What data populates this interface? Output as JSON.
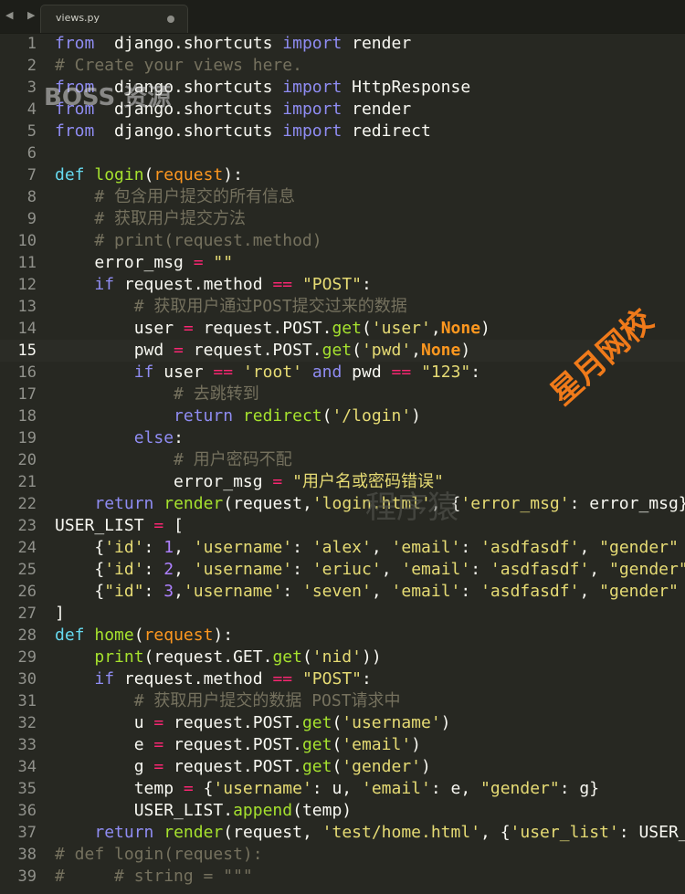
{
  "tabbar": {
    "file_name": "views.py"
  },
  "watermarks": {
    "boss": "BOSS 资源",
    "xingyue": "星月网校",
    "cxy": "程序猿"
  },
  "lines": [
    {
      "n": "1",
      "t": [
        [
          "kw",
          "from"
        ],
        [
          "",
          "  django.shortcuts "
        ],
        [
          "kw",
          "import"
        ],
        [
          "",
          " render"
        ]
      ]
    },
    {
      "n": "2",
      "t": [
        [
          "cmt",
          "# Create your views here."
        ]
      ]
    },
    {
      "n": "3",
      "t": [
        [
          "kw",
          "from"
        ],
        [
          "",
          "  django.shortcuts "
        ],
        [
          "kw",
          "import"
        ],
        [
          "",
          " HttpResponse"
        ]
      ]
    },
    {
      "n": "4",
      "t": [
        [
          "kw",
          "from"
        ],
        [
          "",
          "  django.shortcuts "
        ],
        [
          "kw",
          "import"
        ],
        [
          "",
          " render"
        ]
      ]
    },
    {
      "n": "5",
      "t": [
        [
          "kw",
          "from"
        ],
        [
          "",
          "  django.shortcuts "
        ],
        [
          "kw",
          "import"
        ],
        [
          "",
          " redirect"
        ]
      ]
    },
    {
      "n": "6",
      "t": []
    },
    {
      "n": "7",
      "t": [
        [
          "dkw",
          "def"
        ],
        [
          "",
          " "
        ],
        [
          "fn",
          "login"
        ],
        [
          "",
          "("
        ],
        [
          "param",
          "request"
        ],
        [
          "",
          "):"
        ]
      ]
    },
    {
      "n": "8",
      "t": [
        [
          "",
          "    "
        ],
        [
          "cmt",
          "# 包含用户提交的所有信息"
        ]
      ]
    },
    {
      "n": "9",
      "t": [
        [
          "",
          "    "
        ],
        [
          "cmt",
          "# 获取用户提交方法"
        ]
      ]
    },
    {
      "n": "10",
      "t": [
        [
          "",
          "    "
        ],
        [
          "cmt",
          "# print(request.method)"
        ]
      ]
    },
    {
      "n": "11",
      "t": [
        [
          "",
          "    error_msg "
        ],
        [
          "op",
          "="
        ],
        [
          "",
          " "
        ],
        [
          "str",
          "\"\""
        ]
      ]
    },
    {
      "n": "12",
      "t": [
        [
          "",
          "    "
        ],
        [
          "kw",
          "if"
        ],
        [
          "",
          " request.method "
        ],
        [
          "op",
          "=="
        ],
        [
          "",
          " "
        ],
        [
          "str",
          "\"POST\""
        ],
        [
          "",
          ":"
        ]
      ]
    },
    {
      "n": "13",
      "t": [
        [
          "",
          "        "
        ],
        [
          "cmt",
          "# 获取用户通过POST提交过来的数据"
        ]
      ]
    },
    {
      "n": "14",
      "t": [
        [
          "",
          "        user "
        ],
        [
          "op",
          "="
        ],
        [
          "",
          " request.POST."
        ],
        [
          "fn",
          "get"
        ],
        [
          "",
          "("
        ],
        [
          "str",
          "'user'"
        ],
        [
          "",
          ","
        ],
        [
          "const",
          "None"
        ],
        [
          "",
          ")"
        ]
      ]
    },
    {
      "n": "15",
      "t": [
        [
          "",
          "        pwd "
        ],
        [
          "op",
          "="
        ],
        [
          "",
          " request.POST."
        ],
        [
          "fn",
          "get"
        ],
        [
          "",
          "("
        ],
        [
          "str",
          "'pwd'"
        ],
        [
          "",
          ","
        ],
        [
          "const",
          "None"
        ],
        [
          "",
          ")"
        ]
      ]
    },
    {
      "n": "16",
      "t": [
        [
          "",
          "        "
        ],
        [
          "kw",
          "if"
        ],
        [
          "",
          " user "
        ],
        [
          "op",
          "=="
        ],
        [
          "",
          " "
        ],
        [
          "str",
          "'root'"
        ],
        [
          "",
          " "
        ],
        [
          "kw",
          "and"
        ],
        [
          "",
          " pwd "
        ],
        [
          "op",
          "=="
        ],
        [
          "",
          " "
        ],
        [
          "str",
          "\"123\""
        ],
        [
          "",
          ":"
        ]
      ]
    },
    {
      "n": "17",
      "t": [
        [
          "",
          "            "
        ],
        [
          "cmt",
          "# 去跳转到"
        ]
      ]
    },
    {
      "n": "18",
      "t": [
        [
          "",
          "            "
        ],
        [
          "kw",
          "return"
        ],
        [
          "",
          " "
        ],
        [
          "fn",
          "redirect"
        ],
        [
          "",
          "("
        ],
        [
          "str",
          "'/login'"
        ],
        [
          "",
          ")"
        ]
      ]
    },
    {
      "n": "19",
      "t": [
        [
          "",
          "        "
        ],
        [
          "kw",
          "else"
        ],
        [
          "",
          ":"
        ]
      ]
    },
    {
      "n": "20",
      "t": [
        [
          "",
          "            "
        ],
        [
          "cmt",
          "# 用户密码不配"
        ]
      ]
    },
    {
      "n": "21",
      "t": [
        [
          "",
          "            error_msg "
        ],
        [
          "op",
          "="
        ],
        [
          "",
          " "
        ],
        [
          "str",
          "\"用户名或密码错误\""
        ]
      ]
    },
    {
      "n": "22",
      "t": [
        [
          "",
          "    "
        ],
        [
          "kw",
          "return"
        ],
        [
          "",
          " "
        ],
        [
          "fn",
          "render"
        ],
        [
          "",
          "(request,"
        ],
        [
          "str",
          "'login.html'"
        ],
        [
          "",
          ", {"
        ],
        [
          "str",
          "'error_msg'"
        ],
        [
          "",
          ": error_msg})"
        ]
      ]
    },
    {
      "n": "23",
      "t": [
        [
          "",
          "USER_LIST "
        ],
        [
          "op",
          "="
        ],
        [
          "",
          " ["
        ]
      ]
    },
    {
      "n": "24",
      "t": [
        [
          "",
          "    {"
        ],
        [
          "str",
          "'id'"
        ],
        [
          "",
          ": "
        ],
        [
          "num",
          "1"
        ],
        [
          "",
          ", "
        ],
        [
          "str",
          "'username'"
        ],
        [
          "",
          ": "
        ],
        [
          "str",
          "'alex'"
        ],
        [
          "",
          ", "
        ],
        [
          "str",
          "'email'"
        ],
        [
          "",
          ": "
        ],
        [
          "str",
          "'asdfasdf'"
        ],
        [
          "",
          ", "
        ],
        [
          "str",
          "\"gender\""
        ]
      ]
    },
    {
      "n": "25",
      "t": [
        [
          "",
          "    {"
        ],
        [
          "str",
          "'id'"
        ],
        [
          "",
          ": "
        ],
        [
          "num",
          "2"
        ],
        [
          "",
          ", "
        ],
        [
          "str",
          "'username'"
        ],
        [
          "",
          ": "
        ],
        [
          "str",
          "'eriuc'"
        ],
        [
          "",
          ", "
        ],
        [
          "str",
          "'email'"
        ],
        [
          "",
          ": "
        ],
        [
          "str",
          "'asdfasdf'"
        ],
        [
          "",
          ", "
        ],
        [
          "str",
          "\"gender\""
        ]
      ]
    },
    {
      "n": "26",
      "t": [
        [
          "",
          "    {"
        ],
        [
          "str",
          "\"id\""
        ],
        [
          "",
          ": "
        ],
        [
          "num",
          "3"
        ],
        [
          "",
          ","
        ],
        [
          "str",
          "'username'"
        ],
        [
          "",
          ": "
        ],
        [
          "str",
          "'seven'"
        ],
        [
          "",
          ", "
        ],
        [
          "str",
          "'email'"
        ],
        [
          "",
          ": "
        ],
        [
          "str",
          "'asdfasdf'"
        ],
        [
          "",
          ", "
        ],
        [
          "str",
          "\"gender\""
        ]
      ]
    },
    {
      "n": "27",
      "t": [
        [
          "",
          "]"
        ]
      ]
    },
    {
      "n": "28",
      "t": [
        [
          "dkw",
          "def"
        ],
        [
          "",
          " "
        ],
        [
          "fn",
          "home"
        ],
        [
          "",
          "("
        ],
        [
          "param",
          "request"
        ],
        [
          "",
          "):"
        ]
      ]
    },
    {
      "n": "29",
      "t": [
        [
          "",
          "    "
        ],
        [
          "fn",
          "print"
        ],
        [
          "",
          "(request.GET."
        ],
        [
          "fn",
          "get"
        ],
        [
          "",
          "("
        ],
        [
          "str",
          "'nid'"
        ],
        [
          "",
          "))"
        ]
      ]
    },
    {
      "n": "30",
      "t": [
        [
          "",
          "    "
        ],
        [
          "kw",
          "if"
        ],
        [
          "",
          " request.method "
        ],
        [
          "op",
          "=="
        ],
        [
          "",
          " "
        ],
        [
          "str",
          "\"POST\""
        ],
        [
          "",
          ":"
        ]
      ]
    },
    {
      "n": "31",
      "t": [
        [
          "",
          "        "
        ],
        [
          "cmt",
          "# 获取用户提交的数据 POST请求中"
        ]
      ]
    },
    {
      "n": "32",
      "t": [
        [
          "",
          "        u "
        ],
        [
          "op",
          "="
        ],
        [
          "",
          " request.POST."
        ],
        [
          "fn",
          "get"
        ],
        [
          "",
          "("
        ],
        [
          "str",
          "'username'"
        ],
        [
          "",
          ")"
        ]
      ]
    },
    {
      "n": "33",
      "t": [
        [
          "",
          "        e "
        ],
        [
          "op",
          "="
        ],
        [
          "",
          " request.POST."
        ],
        [
          "fn",
          "get"
        ],
        [
          "",
          "("
        ],
        [
          "str",
          "'email'"
        ],
        [
          "",
          ")"
        ]
      ]
    },
    {
      "n": "34",
      "t": [
        [
          "",
          "        g "
        ],
        [
          "op",
          "="
        ],
        [
          "",
          " request.POST."
        ],
        [
          "fn",
          "get"
        ],
        [
          "",
          "("
        ],
        [
          "str",
          "'gender'"
        ],
        [
          "",
          ")"
        ]
      ]
    },
    {
      "n": "35",
      "t": [
        [
          "",
          "        temp "
        ],
        [
          "op",
          "="
        ],
        [
          "",
          " {"
        ],
        [
          "str",
          "'username'"
        ],
        [
          "",
          ": u, "
        ],
        [
          "str",
          "'email'"
        ],
        [
          "",
          ": e, "
        ],
        [
          "str",
          "\"gender\""
        ],
        [
          "",
          ": g}"
        ]
      ]
    },
    {
      "n": "36",
      "t": [
        [
          "",
          "        USER_LIST."
        ],
        [
          "fn",
          "append"
        ],
        [
          "",
          "(temp)"
        ]
      ]
    },
    {
      "n": "37",
      "t": [
        [
          "",
          "    "
        ],
        [
          "kw",
          "return"
        ],
        [
          "",
          " "
        ],
        [
          "fn",
          "render"
        ],
        [
          "",
          "(request, "
        ],
        [
          "str",
          "'test/home.html'"
        ],
        [
          "",
          ", {"
        ],
        [
          "str",
          "'user_list'"
        ],
        [
          "",
          ": USER_LIST})"
        ]
      ]
    },
    {
      "n": "38",
      "t": [
        [
          "cmt",
          "# def login(request):"
        ]
      ]
    },
    {
      "n": "39",
      "t": [
        [
          "cmt",
          "#     # string = \"\"\""
        ]
      ]
    }
  ],
  "current_line": "15"
}
